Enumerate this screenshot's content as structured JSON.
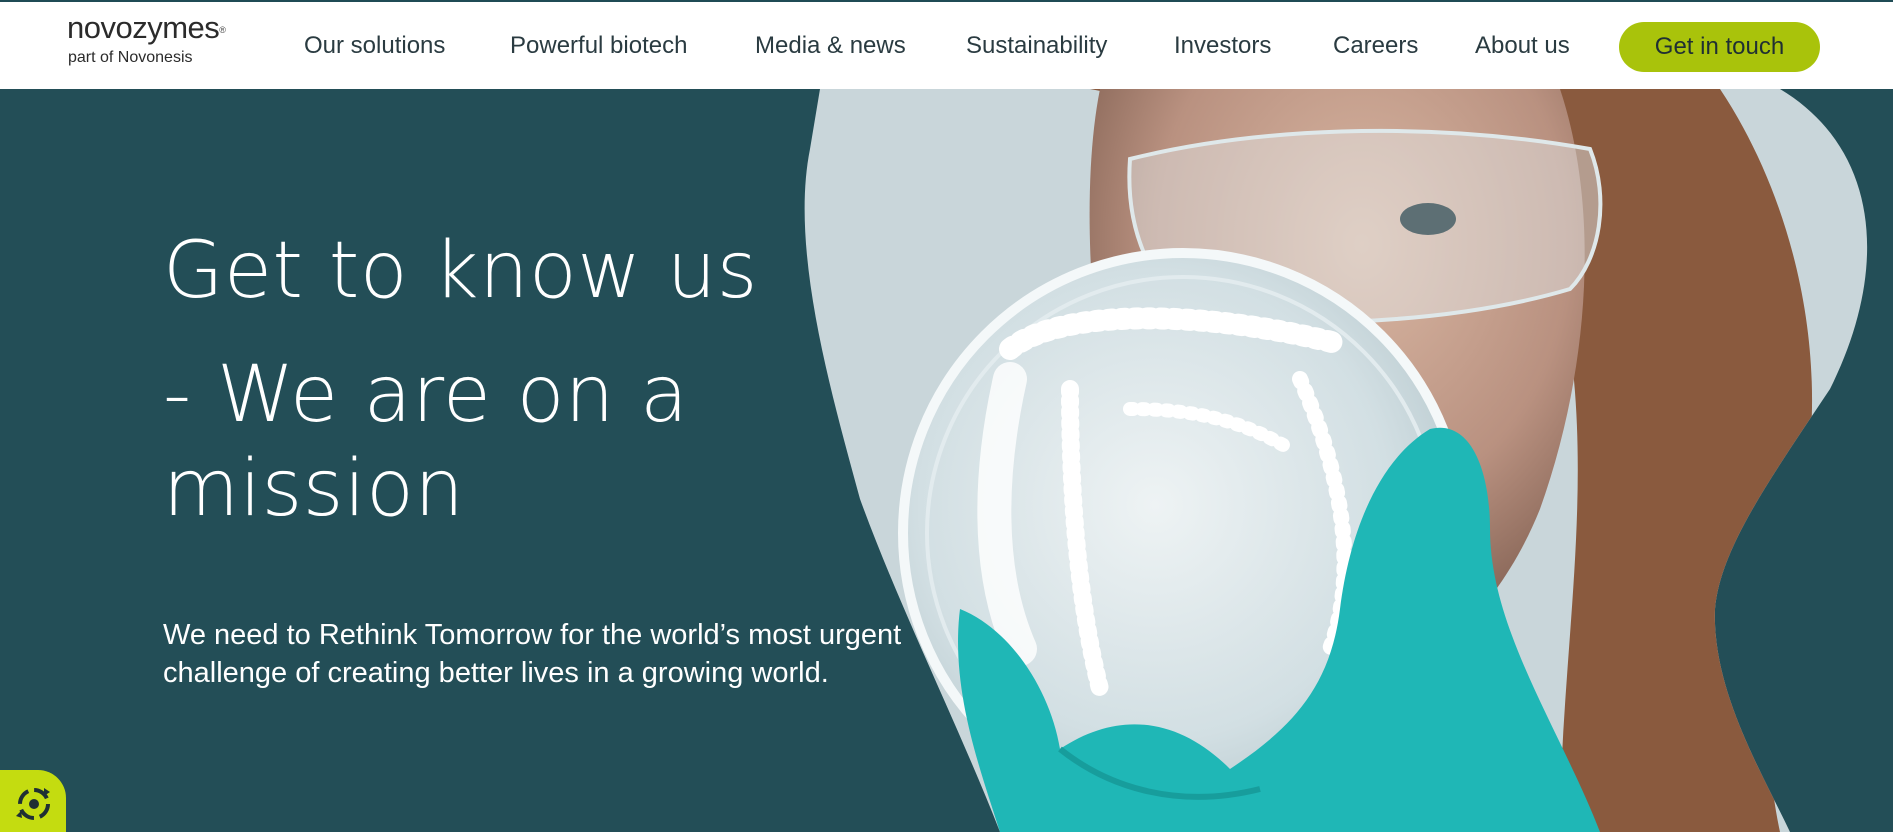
{
  "header": {
    "logo": {
      "brand": "novozymes",
      "registered": "®",
      "subtitle": "part of Novonesis"
    },
    "nav": [
      "Our solutions",
      "Powerful biotech",
      "Media & news",
      "Sustainability",
      "Investors",
      "Careers",
      "About us"
    ],
    "cta_label": "Get in touch"
  },
  "hero": {
    "heading_lines": [
      "Get to know us",
      "- We are on a",
      "mission"
    ],
    "description": "We need to Rethink Tomorrow for the world’s most urgent challenge of creating better lives in a growing world.",
    "image_alt": "Scientist in protective glasses and teal gloves holding up a petri dish"
  },
  "widget": {
    "icon": "accessibility-recycle-icon"
  },
  "colors": {
    "hero_bg": "#234e57",
    "accent": "#a9c30b",
    "widget": "#c4dc10",
    "glove": "#1fb7b6",
    "text_dark": "#2a3b41"
  }
}
